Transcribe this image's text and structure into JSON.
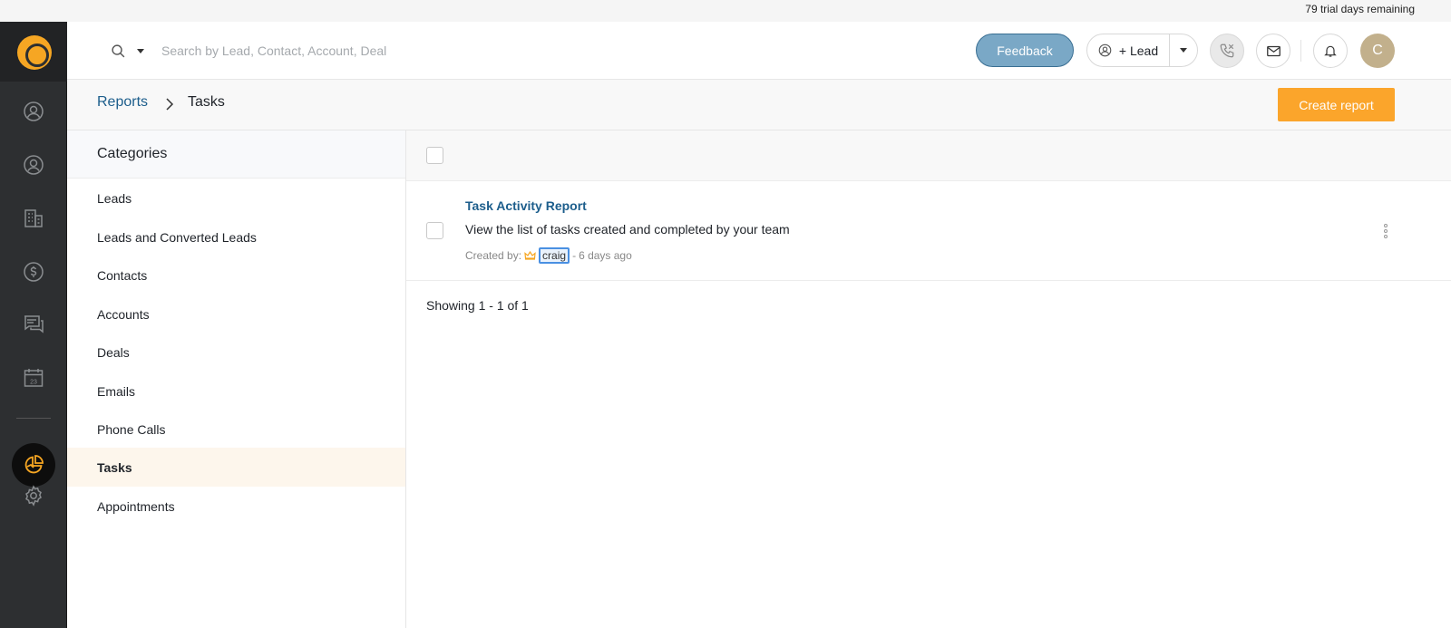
{
  "trial": {
    "text": "79 trial days remaining"
  },
  "rail": {
    "items": [
      {
        "icon": "leads-icon"
      },
      {
        "icon": "contacts-icon"
      },
      {
        "icon": "accounts-icon"
      },
      {
        "icon": "deals-icon"
      },
      {
        "icon": "conversations-icon"
      },
      {
        "icon": "calendar-icon",
        "date": "23"
      },
      {
        "icon": "reports-icon",
        "active": true
      },
      {
        "icon": "settings-icon"
      }
    ],
    "accent": "#f6a623"
  },
  "topbar": {
    "search_placeholder": "Search by Lead, Contact, Account, Deal",
    "feedback_label": "Feedback",
    "lead_label": "+ Lead",
    "avatar_initial": "C"
  },
  "breadcrumb": {
    "parent": "Reports",
    "current": "Tasks"
  },
  "actions": {
    "create_report": "Create report"
  },
  "categories": {
    "title": "Categories",
    "items": [
      {
        "label": "Leads"
      },
      {
        "label": "Leads and Converted Leads"
      },
      {
        "label": "Contacts"
      },
      {
        "label": "Accounts"
      },
      {
        "label": "Deals"
      },
      {
        "label": "Emails"
      },
      {
        "label": "Phone Calls"
      },
      {
        "label": "Tasks",
        "active": true
      },
      {
        "label": "Appointments"
      }
    ]
  },
  "reports": [
    {
      "title": "Task Activity Report",
      "description": "View the list of tasks created and completed by your team",
      "created_by_label": "Created by:",
      "creator": "craig",
      "separator": "-",
      "age": "6 days ago"
    }
  ],
  "pagination": {
    "text": "Showing 1 - 1 of 1"
  },
  "colors": {
    "primary_link": "#1d5e8c",
    "create_button": "#fba52b",
    "feedback_button": "#7aa8c6",
    "active_category": "#fdf6ec"
  }
}
